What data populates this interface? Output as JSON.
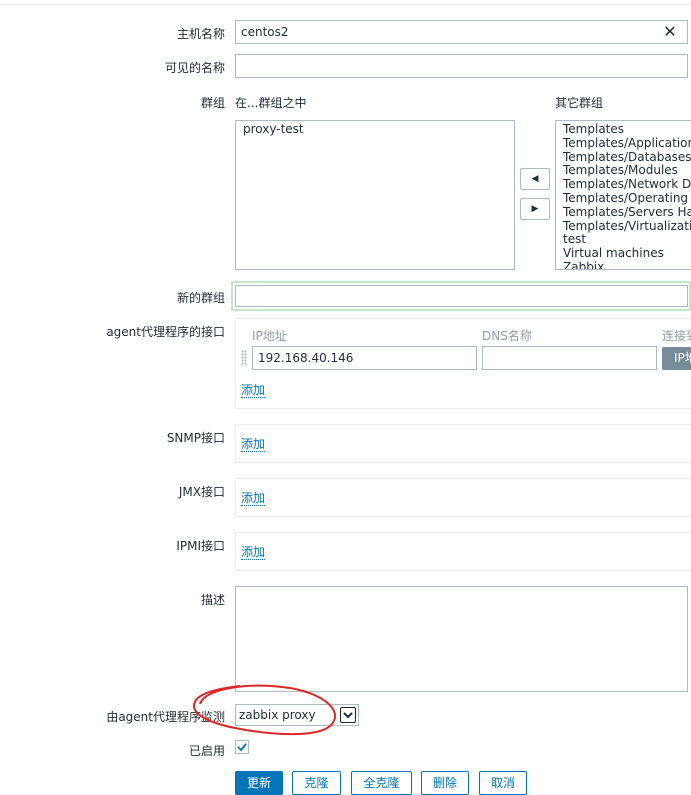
{
  "form": {
    "host_name": {
      "label": "主机名称",
      "value": "centos2"
    },
    "visible_name": {
      "label": "可见的名称",
      "value": ""
    },
    "groups": {
      "label": "群组",
      "in_groups_title": "在...群组之中",
      "other_groups_title": "其它群组",
      "in_groups": [
        "proxy-test"
      ],
      "other_groups": [
        "Templates",
        "Templates/Applications",
        "Templates/Databases",
        "Templates/Modules",
        "Templates/Network Dev",
        "Templates/Operating Sy",
        "Templates/Servers Hard",
        "Templates/Virtualization",
        "test",
        "Virtual machines",
        "Zabbix"
      ],
      "move_left": "◀",
      "move_right": "▶"
    },
    "new_group": {
      "label": "新的群组",
      "value": ""
    },
    "agent_interfaces": {
      "label": "agent代理程序的接口",
      "col_ip": "IP地址",
      "col_dns": "DNS名称",
      "col_connect": "连接到",
      "ip_value": "192.168.40.146",
      "dns_value": "",
      "ip_button": "IP地",
      "add": "添加"
    },
    "snmp": {
      "label": "SNMP接口",
      "add": "添加"
    },
    "jmx": {
      "label": "JMX接口",
      "add": "添加"
    },
    "ipmi": {
      "label": "IPMI接口",
      "add": "添加"
    },
    "description": {
      "label": "描述",
      "value": ""
    },
    "monitored_by_proxy": {
      "label": "由agent代理程序监测",
      "selected": "zabbix proxy"
    },
    "enabled": {
      "label": "已启用",
      "checked": true
    }
  },
  "buttons": {
    "update": "更新",
    "clone": "克隆",
    "full_clone": "全克隆",
    "delete": "删除",
    "cancel": "取消"
  },
  "colors": {
    "accent": "#0275b8",
    "annotation": "#e0262a",
    "new_group_focus": "#c8e6c9"
  }
}
